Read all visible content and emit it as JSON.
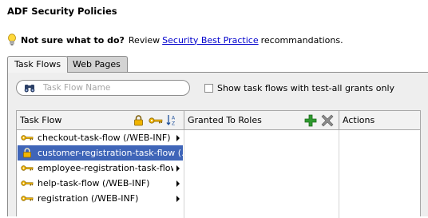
{
  "page": {
    "title": "ADF Security Policies"
  },
  "hint": {
    "bold": "Not sure what to do?",
    "review": "Review",
    "link": "Security Best Practice",
    "tail": "recommandations."
  },
  "tabs": [
    {
      "label": "Task Flows",
      "active": true
    },
    {
      "label": "Web Pages",
      "active": false
    }
  ],
  "filter": {
    "placeholder": "Task Flow Name",
    "show_all_label": "Show task flows with test-all grants only",
    "show_all_checked": false
  },
  "table": {
    "columns": [
      "Task Flow",
      "Granted To Roles",
      "Actions"
    ],
    "rows": [
      {
        "label": "checkout-task-flow (/WEB-INF)",
        "icon": "key-icon",
        "selected": false
      },
      {
        "label": "customer-registration-task-flow (...)",
        "icon": "lock-icon",
        "selected": true
      },
      {
        "label": "employee-registration-task-flow (...",
        "icon": "key-icon",
        "selected": false
      },
      {
        "label": "help-task-flow (/WEB-INF)",
        "icon": "key-icon",
        "selected": false
      },
      {
        "label": "registration (/WEB-INF)",
        "icon": "key-icon",
        "selected": false
      }
    ]
  },
  "colors": {
    "selection": "#3f65b8",
    "link": "#0000cc",
    "add": "#2f9a2f",
    "key": "#d4a017"
  }
}
